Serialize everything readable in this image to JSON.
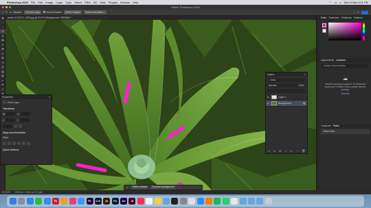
{
  "menubar": {
    "app": "Photoshop 2024",
    "items": [
      "File",
      "Edit",
      "Image",
      "Layer",
      "Type",
      "Select",
      "Filter",
      "3D",
      "View",
      "Plugins",
      "Window",
      "Help"
    ],
    "datetime": "Wed 9 Mar 5:01 PM"
  },
  "window": {
    "title": "Adobe Photoshop 2024"
  },
  "options": {
    "sample_label": "Sample:",
    "sample_value": "Current Layer",
    "auto_enhance": "Auto-Enhance",
    "select_subject": "Select Subject",
    "select_and_mask": "Select and Mask..."
  },
  "document": {
    "tab": "photo-3719172_1920.jpg @ 33.3% (Background, RGB/8#) *"
  },
  "toolbar": {
    "tools": [
      "move-tool",
      "marquee-tool",
      "lasso-tool",
      "quick-selection-tool",
      "crop-tool",
      "frame-tool",
      "eyedropper-tool",
      "healing-brush-tool",
      "brush-tool",
      "clone-stamp-tool",
      "history-brush-tool",
      "eraser-tool",
      "gradient-tool",
      "blur-tool",
      "dodge-tool",
      "pen-tool",
      "type-tool",
      "path-selection-tool",
      "rectangle-tool",
      "hand-tool",
      "zoom-tool",
      "more-tools"
    ],
    "glyphs": [
      "✥",
      "⬚",
      "◌",
      "✎",
      "⌗",
      "⊠",
      "⌖",
      "✚",
      "✏",
      "⎈",
      "↺",
      "◫",
      "▤",
      "◍",
      "◐",
      "✒",
      "T",
      "➤",
      "▭",
      "✋",
      "⌕",
      "…"
    ],
    "foreground_color": "#ff00c8",
    "background_color": "#ffffff"
  },
  "properties": {
    "title": "Properties",
    "subtitle": "Pixel Layer",
    "transform": "Transform",
    "align": "Align and Distribute",
    "align_label": "Align:",
    "quick_actions": "Quick Actions"
  },
  "layers": {
    "title": "Layers",
    "kind_label": "Kind",
    "blend": "Normal",
    "opacity": "100%",
    "items": [
      {
        "name": "Layer 1",
        "thumb_color": "#e8e8e8"
      },
      {
        "name": "Background",
        "thumb_color": "#4a7a2a"
      }
    ],
    "footer_icons": [
      "link-icon",
      "fx-icon",
      "mask-icon",
      "adjustment-icon",
      "folder-icon",
      "new-layer-icon",
      "trash-icon"
    ],
    "footer_glyphs": [
      "∞",
      "fx",
      "◘",
      "◑",
      "▭",
      "+",
      "🗑"
    ]
  },
  "taskbar": {
    "select_subject": "Select subject",
    "remove_background": "Remove background"
  },
  "right_panel": {
    "color_tabs": [
      "Color",
      "Swatches",
      "Gradients",
      "Patterns"
    ],
    "lib_tabs": [
      "Adjustments",
      "Libraries"
    ],
    "lib_dropdown": "Creative Cloud Libraries",
    "lib_message": "Libraries syncing is paused. To follow and share your Creative Cloud, please resume syncing.",
    "lib_link": "Resume",
    "channel_tabs": [
      "Channels",
      "Paths"
    ],
    "channel_row": "Work Path"
  },
  "status": {
    "zoom": "33.33%",
    "doc_info": "1920 px x 1080 px (72 ppi)"
  },
  "dock": {
    "apps": [
      {
        "icon": "finder-icon",
        "label": "",
        "color": "#3a7be0"
      },
      {
        "icon": "launchpad-icon",
        "label": "",
        "color": "#8a8fa0"
      },
      {
        "icon": "safari-icon",
        "label": "",
        "color": "#2a8ae0"
      },
      {
        "icon": "messages-icon",
        "label": "",
        "color": "#2fb84a"
      },
      {
        "icon": "mail-icon",
        "label": "",
        "color": "#3a8af0"
      },
      {
        "icon": "filezilla-icon",
        "label": "Fz",
        "color": "#c0262d"
      },
      {
        "icon": "photos-icon",
        "label": "",
        "color": "#e8a030"
      },
      {
        "icon": "itunes-icon",
        "label": "",
        "color": "#e04080"
      },
      {
        "icon": "app-store-icon",
        "label": "",
        "color": "#3a9af0"
      },
      {
        "icon": "premiere-icon",
        "label": "Pr",
        "color": "#2a0a40"
      },
      {
        "icon": "lightroom-classic-icon",
        "label": "LrC",
        "color": "#0a1a30"
      },
      {
        "icon": "illustrator-icon",
        "label": "Ai",
        "color": "#3a1e00"
      },
      {
        "icon": "photoshop-icon",
        "label": "Ps",
        "color": "#001e36"
      },
      {
        "icon": "after-effects-icon",
        "label": "Ae",
        "color": "#1a0040"
      },
      {
        "icon": "indesign-icon",
        "label": "Id",
        "color": "#49021f"
      },
      {
        "icon": "music-icon",
        "label": "",
        "color": "#f03050"
      },
      {
        "icon": "calendar-icon",
        "label": "",
        "color": "#f2f2f2"
      },
      {
        "icon": "notes-icon",
        "label": "",
        "color": "#f0d040"
      },
      {
        "icon": "preview-icon",
        "label": "",
        "color": "#6aa0e0"
      },
      {
        "icon": "terminal-icon",
        "label": "",
        "color": "#222222"
      },
      {
        "icon": "system-settings-icon",
        "label": "",
        "color": "#888888"
      },
      {
        "icon": "chrome-icon",
        "label": "",
        "color": "#e0e0e0"
      },
      {
        "icon": "zoom-icon",
        "label": "",
        "color": "#2d8cff"
      },
      {
        "icon": "vlc-icon",
        "label": "",
        "color": "#f08000"
      },
      {
        "icon": "spotify-icon",
        "label": "",
        "color": "#1db954"
      },
      {
        "icon": "whatsapp-icon",
        "label": "",
        "color": "#25d366"
      },
      {
        "icon": "textedit-icon",
        "label": "",
        "color": "#e8e8e8"
      },
      {
        "icon": "folder-icon",
        "label": "",
        "color": "#60a8e8"
      },
      {
        "icon": "folder-icon",
        "label": "",
        "color": "#60a8e8"
      },
      {
        "icon": "downloads-icon",
        "label": "",
        "color": "#60a8e8"
      },
      {
        "icon": "trash-icon",
        "label": "",
        "color": "#c8ccd0"
      }
    ]
  }
}
